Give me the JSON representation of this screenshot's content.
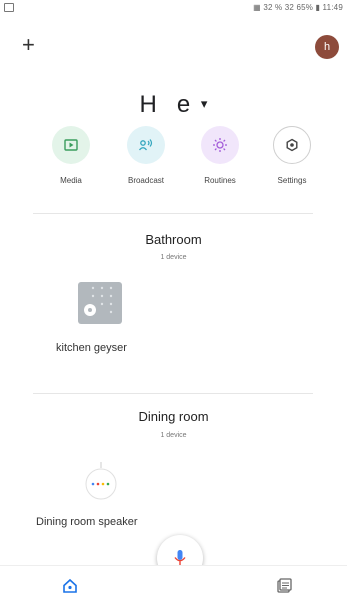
{
  "status": {
    "right": "▦ 32 % 32 65% ▮ 11:49"
  },
  "header": {
    "add_glyph": "+",
    "avatar_letter": "h"
  },
  "home": {
    "title": "H   e",
    "caret": "▾"
  },
  "actions": [
    {
      "label": "Media",
      "bg": "#e3f4e9",
      "fg": "#3a9d5d"
    },
    {
      "label": "Broadcast",
      "bg": "#e1f3f7",
      "fg": "#34a6be"
    },
    {
      "label": "Routines",
      "bg": "#f1e6fb",
      "fg": "#a35bd9"
    },
    {
      "label": "Settings",
      "bg": "#ffffff",
      "fg": "#555555"
    }
  ],
  "rooms": [
    {
      "name": "Bathroom",
      "count": "1 device",
      "device": "kitchen geyser"
    },
    {
      "name": "Dining room",
      "count": "1 device",
      "device": "Dining room speaker"
    }
  ],
  "nav": {
    "home_color": "#1a73e8"
  }
}
